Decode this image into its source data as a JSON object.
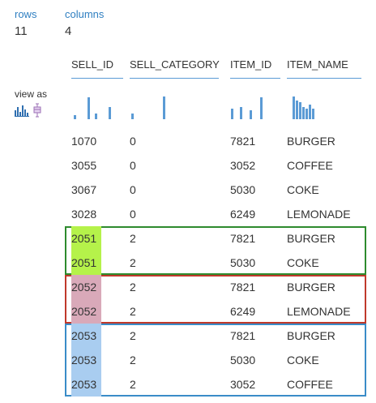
{
  "summary": {
    "rows_label": "rows",
    "rows_value": "11",
    "columns_label": "columns",
    "columns_value": "4"
  },
  "view_as_label": "view as",
  "columns": [
    "SELL_ID",
    "SELL_CATEGORY",
    "ITEM_ID",
    "ITEM_NAME"
  ],
  "rows": [
    [
      "1070",
      "0",
      "7821",
      "BURGER"
    ],
    [
      "3055",
      "0",
      "3052",
      "COFFEE"
    ],
    [
      "3067",
      "0",
      "5030",
      "COKE"
    ],
    [
      "3028",
      "0",
      "6249",
      "LEMONADE"
    ],
    [
      "2051",
      "2",
      "7821",
      "BURGER"
    ],
    [
      "2051",
      "2",
      "5030",
      "COKE"
    ],
    [
      "2052",
      "2",
      "7821",
      "BURGER"
    ],
    [
      "2052",
      "2",
      "6249",
      "LEMONADE"
    ],
    [
      "2053",
      "2",
      "7821",
      "BURGER"
    ],
    [
      "2053",
      "2",
      "5030",
      "COKE"
    ],
    [
      "2053",
      "2",
      "3052",
      "COFFEE"
    ]
  ],
  "groups": [
    {
      "sell_id": "2051",
      "border_color": "#2e8b2e",
      "highlight_color": "#b5f24a"
    },
    {
      "sell_id": "2052",
      "border_color": "#c0392b",
      "highlight_color": "#d9a9b9"
    },
    {
      "sell_id": "2053",
      "border_color": "#3a8cc8",
      "highlight_color": "#a9cdf0"
    }
  ],
  "icons": [
    "histogram-view-icon",
    "boxplot-view-icon"
  ],
  "colors": {
    "accent": "#2f7fc1",
    "header_underline": "#5b9bd5",
    "sparkbar": "#5b9bd5"
  }
}
